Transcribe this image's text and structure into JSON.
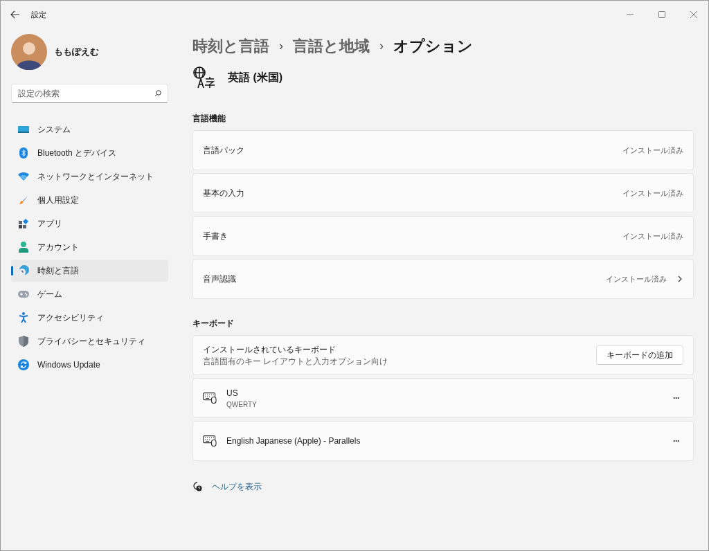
{
  "window": {
    "title": "設定"
  },
  "user": {
    "name": "ももぽえむ"
  },
  "search": {
    "placeholder": "設定の検索"
  },
  "nav": [
    {
      "label": "システム",
      "selected": false
    },
    {
      "label": "Bluetooth とデバイス",
      "selected": false
    },
    {
      "label": "ネットワークとインターネット",
      "selected": false
    },
    {
      "label": "個人用設定",
      "selected": false
    },
    {
      "label": "アプリ",
      "selected": false
    },
    {
      "label": "アカウント",
      "selected": false
    },
    {
      "label": "時刻と言語",
      "selected": true
    },
    {
      "label": "ゲーム",
      "selected": false
    },
    {
      "label": "アクセシビリティ",
      "selected": false
    },
    {
      "label": "プライバシーとセキュリティ",
      "selected": false
    },
    {
      "label": "Windows Update",
      "selected": false
    }
  ],
  "breadcrumb": [
    {
      "label": "時刻と言語",
      "current": false
    },
    {
      "label": "言語と地域",
      "current": false
    },
    {
      "label": "オプション",
      "current": true
    }
  ],
  "breadcrumb_separator": "›",
  "language": {
    "name": "英語 (米国)"
  },
  "language_features": {
    "heading": "言語機能",
    "rows": [
      {
        "label": "言語パック",
        "status": "インストール済み",
        "navigable": false
      },
      {
        "label": "基本の入力",
        "status": "インストール済み",
        "navigable": false
      },
      {
        "label": "手書き",
        "status": "インストール済み",
        "navigable": false
      },
      {
        "label": "音声認識",
        "status": "インストール済み",
        "navigable": true
      }
    ]
  },
  "keyboard": {
    "heading": "キーボード",
    "title": "インストールされているキーボード",
    "subtitle": "言語固有のキー レイアウトと入力オプション向け",
    "add_button": "キーボードの追加",
    "keyboards": [
      {
        "name": "US",
        "layout": "QWERTY",
        "more": "···"
      },
      {
        "name": "English Japanese (Apple) - Parallels",
        "more": "···"
      }
    ]
  },
  "help_link": "ヘルプを表示"
}
